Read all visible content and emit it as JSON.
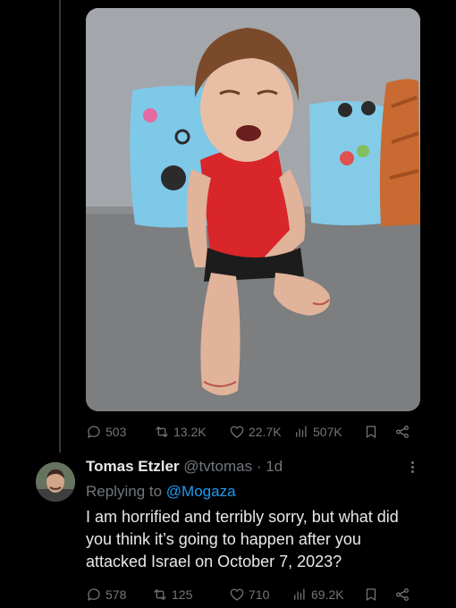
{
  "tweet1": {
    "media_alt_icon": "photo-child-crying",
    "stats": {
      "replies": "503",
      "retweets": "13.2K",
      "likes": "22.7K",
      "views": "507K"
    }
  },
  "reply": {
    "author_name": "Tomas Etzler",
    "handle": "@tvtomas",
    "separator": "·",
    "time": "1d",
    "replying_to_label": "Replying to",
    "replying_to_handle": "@Mogaza",
    "text": "I am horrified and terribly sorry, but what did you think it’s going to happen after you attacked Israel on October 7, 2023?",
    "stats": {
      "replies": "578",
      "retweets": "125",
      "likes": "710",
      "views": "69.2K"
    }
  },
  "colors": {
    "background": "#000000",
    "text": "#e7e9ea",
    "muted": "#71767b",
    "link": "#1d9bf0"
  }
}
